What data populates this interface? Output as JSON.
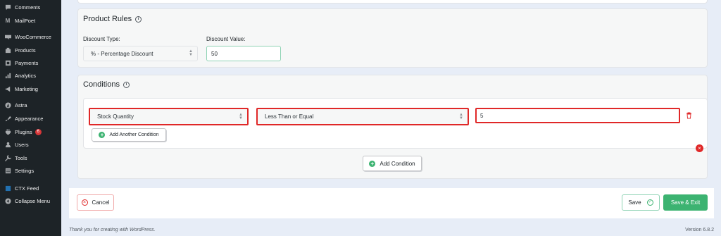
{
  "sidebar": {
    "items": [
      {
        "label": "Comments",
        "icon": "comments-icon"
      },
      {
        "label": "MailPoet",
        "icon": "mailpoet-icon"
      },
      {
        "label": "WooCommerce",
        "icon": "woocommerce-icon"
      },
      {
        "label": "Products",
        "icon": "products-icon"
      },
      {
        "label": "Payments",
        "icon": "payments-icon"
      },
      {
        "label": "Analytics",
        "icon": "analytics-icon"
      },
      {
        "label": "Marketing",
        "icon": "marketing-icon"
      },
      {
        "label": "Astra",
        "icon": "astra-icon"
      },
      {
        "label": "Appearance",
        "icon": "appearance-icon"
      },
      {
        "label": "Plugins",
        "icon": "plugins-icon",
        "badge": "6"
      },
      {
        "label": "Users",
        "icon": "users-icon"
      },
      {
        "label": "Tools",
        "icon": "tools-icon"
      },
      {
        "label": "Settings",
        "icon": "settings-icon"
      },
      {
        "label": "CTX Feed",
        "icon": "ctx-feed-icon"
      },
      {
        "label": "Collapse Menu",
        "icon": "collapse-menu-icon"
      }
    ]
  },
  "product_rules": {
    "title": "Product Rules",
    "discount_type_label": "Discount Type:",
    "discount_type_value": "% - Percentage Discount",
    "discount_value_label": "Discount Value:",
    "discount_value": "50"
  },
  "conditions": {
    "title": "Conditions",
    "field_value": "Stock Quantity",
    "operator_value": "Less Than or Equal",
    "condition_value": "5",
    "add_another_label": "Add Another Condition",
    "add_condition_label": "Add Condition"
  },
  "footer": {
    "cancel_label": "Cancel",
    "save_label": "Save",
    "save_exit_label": "Save & Exit",
    "thanks_text": "Thank you for creating with WordPress.",
    "version_text": "Version 6.8.2"
  },
  "colors": {
    "accent_green": "#3cb371",
    "error_red": "#e02828",
    "sidebar_bg": "#1d2327"
  }
}
